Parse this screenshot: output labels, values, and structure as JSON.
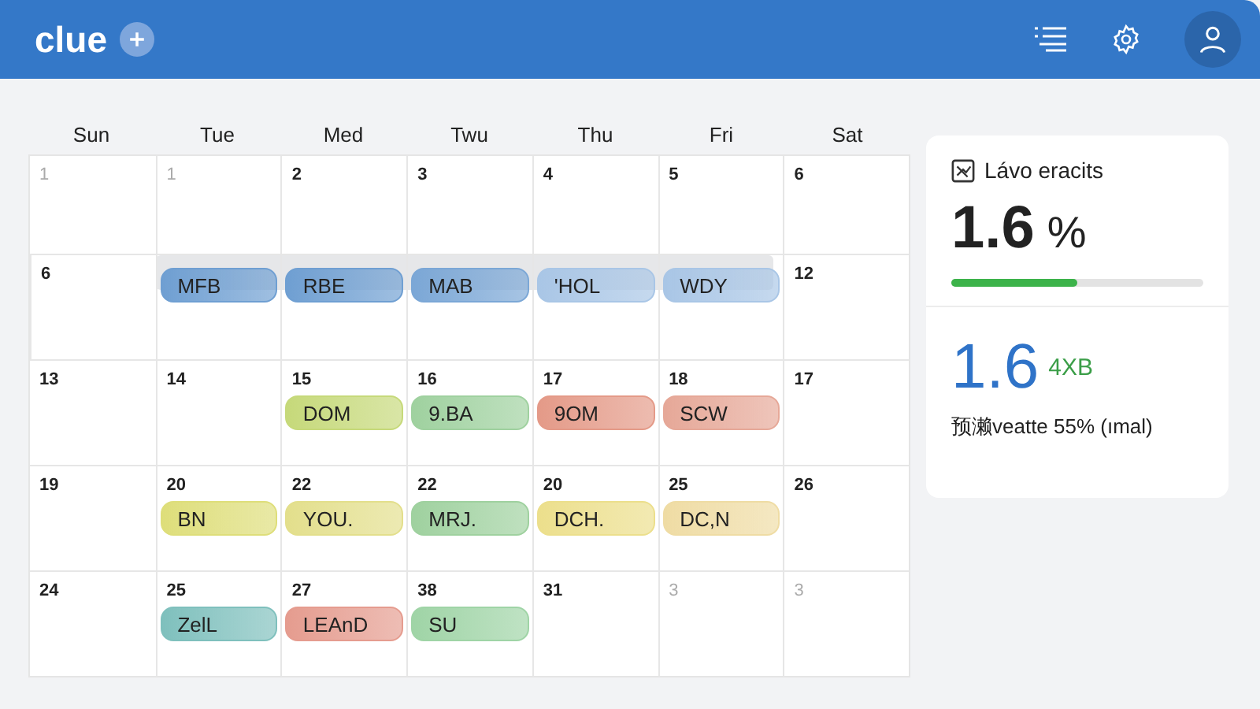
{
  "app": {
    "logo": "clue"
  },
  "calendar": {
    "weekdays": [
      "Sun",
      "Tue",
      "Med",
      "Twu",
      "Thu",
      "Fri",
      "Sat"
    ],
    "weeks": [
      {
        "banded": false,
        "days": [
          {
            "day": "1",
            "muted": true
          },
          {
            "day": "1",
            "muted": true
          },
          {
            "day": "2",
            "muted": false
          },
          {
            "day": "3",
            "muted": false
          },
          {
            "day": "4",
            "muted": false
          },
          {
            "day": "5",
            "muted": false
          },
          {
            "day": "6",
            "muted": false
          }
        ]
      },
      {
        "banded": true,
        "days": [
          {
            "day": "6",
            "muted": false
          },
          {
            "event": {
              "label": "MFB",
              "color": "#6f9fd2"
            }
          },
          {
            "event": {
              "label": "RBE",
              "color": "#6f9fd2"
            }
          },
          {
            "event": {
              "label": "MAB",
              "color": "#7ba7d6"
            }
          },
          {
            "event": {
              "label": "'HOL",
              "color": "#a9c6e6"
            }
          },
          {
            "event": {
              "label": "WDY",
              "color": "#a9c6e6"
            }
          },
          {
            "day": "12",
            "muted": false
          }
        ]
      },
      {
        "banded": false,
        "days": [
          {
            "day": "13",
            "muted": false
          },
          {
            "day": "14",
            "muted": false
          },
          {
            "day": "15",
            "muted": false,
            "event": {
              "label": "DOM",
              "color": "#c6d97a"
            }
          },
          {
            "day": "16",
            "muted": false,
            "event": {
              "label": "9.BA",
              "color": "#9fd19f"
            }
          },
          {
            "day": "17",
            "muted": false,
            "event": {
              "label": "9OM",
              "color": "#e49a88"
            }
          },
          {
            "day": "18",
            "muted": false,
            "event": {
              "label": "SCW",
              "color": "#e6a898"
            }
          },
          {
            "day": "17",
            "muted": false
          }
        ]
      },
      {
        "banded": false,
        "days": [
          {
            "day": "19",
            "muted": false
          },
          {
            "day": "20",
            "muted": false,
            "event": {
              "label": "BN",
              "color": "#dede7a"
            }
          },
          {
            "day": "22",
            "muted": false,
            "event": {
              "label": "YOU.",
              "color": "#e3df8c"
            }
          },
          {
            "day": "22",
            "muted": false,
            "event": {
              "label": "MRJ.",
              "color": "#9fd19f"
            }
          },
          {
            "day": "20",
            "muted": false,
            "event": {
              "label": "DCH.",
              "color": "#ecdf8c"
            }
          },
          {
            "day": "25",
            "muted": false,
            "event": {
              "label": "DC,N",
              "color": "#efdca4"
            }
          },
          {
            "day": "26",
            "muted": false
          }
        ]
      },
      {
        "banded": false,
        "days": [
          {
            "day": "24",
            "muted": false
          },
          {
            "day": "25",
            "muted": false,
            "event": {
              "label": "ZelL",
              "color": "#7fc0bd"
            }
          },
          {
            "day": "27",
            "muted": false,
            "event": {
              "label": "LEAnD",
              "color": "#e59c8f"
            }
          },
          {
            "day": "38",
            "muted": false,
            "event": {
              "label": "SU",
              "color": "#9fd4a6"
            }
          },
          {
            "day": "31",
            "muted": false
          },
          {
            "day": "3",
            "muted": true
          },
          {
            "day": "3",
            "muted": true
          }
        ]
      }
    ]
  },
  "stats": {
    "title": "Lávo eracits",
    "value": "1.6",
    "unit": "%",
    "level": 0.5,
    "second_value": "1.6",
    "second_badge": "4XB",
    "note": "预濑veatte 55% (ımal)"
  }
}
